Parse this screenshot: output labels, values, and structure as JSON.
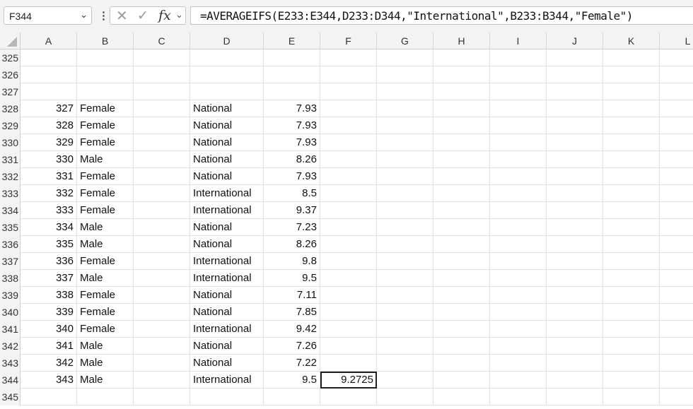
{
  "namebox": {
    "value": "F344"
  },
  "formula_bar": {
    "formula": "=AVERAGEIFS(E233:E344,D233:D344,\"International\",B233:B344,\"Female\")"
  },
  "columns": [
    "A",
    "B",
    "C",
    "D",
    "E",
    "F",
    "G",
    "H",
    "I",
    "J",
    "K",
    "L"
  ],
  "rows": [
    {
      "num": "325",
      "A": "",
      "B": "",
      "D": "",
      "E": "",
      "F": ""
    },
    {
      "num": "326",
      "A": "",
      "B": "",
      "D": "",
      "E": "",
      "F": ""
    },
    {
      "num": "327",
      "A": "",
      "B": "",
      "D": "",
      "E": "",
      "F": ""
    },
    {
      "num": "328",
      "A": "327",
      "B": "Female",
      "D": "National",
      "E": "7.93",
      "F": ""
    },
    {
      "num": "329",
      "A": "328",
      "B": "Female",
      "D": "National",
      "E": "7.93",
      "F": ""
    },
    {
      "num": "330",
      "A": "329",
      "B": "Female",
      "D": "National",
      "E": "7.93",
      "F": ""
    },
    {
      "num": "331",
      "A": "330",
      "B": "Male",
      "D": "National",
      "E": "8.26",
      "F": ""
    },
    {
      "num": "332",
      "A": "331",
      "B": "Female",
      "D": "National",
      "E": "7.93",
      "F": ""
    },
    {
      "num": "333",
      "A": "332",
      "B": "Female",
      "D": "International",
      "E": "8.5",
      "F": ""
    },
    {
      "num": "334",
      "A": "333",
      "B": "Female",
      "D": "International",
      "E": "9.37",
      "F": ""
    },
    {
      "num": "335",
      "A": "334",
      "B": "Male",
      "D": "National",
      "E": "7.23",
      "F": ""
    },
    {
      "num": "336",
      "A": "335",
      "B": "Male",
      "D": "National",
      "E": "8.26",
      "F": ""
    },
    {
      "num": "337",
      "A": "336",
      "B": "Female",
      "D": "International",
      "E": "9.8",
      "F": ""
    },
    {
      "num": "338",
      "A": "337",
      "B": "Male",
      "D": "International",
      "E": "9.5",
      "F": ""
    },
    {
      "num": "339",
      "A": "338",
      "B": "Female",
      "D": "National",
      "E": "7.11",
      "F": ""
    },
    {
      "num": "340",
      "A": "339",
      "B": "Female",
      "D": "National",
      "E": "7.85",
      "F": ""
    },
    {
      "num": "341",
      "A": "340",
      "B": "Female",
      "D": "International",
      "E": "9.42",
      "F": ""
    },
    {
      "num": "342",
      "A": "341",
      "B": "Male",
      "D": "National",
      "E": "7.26",
      "F": ""
    },
    {
      "num": "343",
      "A": "342",
      "B": "Male",
      "D": "National",
      "E": "7.22",
      "F": ""
    },
    {
      "num": "344",
      "A": "343",
      "B": "Male",
      "D": "International",
      "E": "9.5",
      "F": "9.2725"
    },
    {
      "num": "345",
      "A": "",
      "B": "",
      "D": "",
      "E": "",
      "F": ""
    }
  ]
}
